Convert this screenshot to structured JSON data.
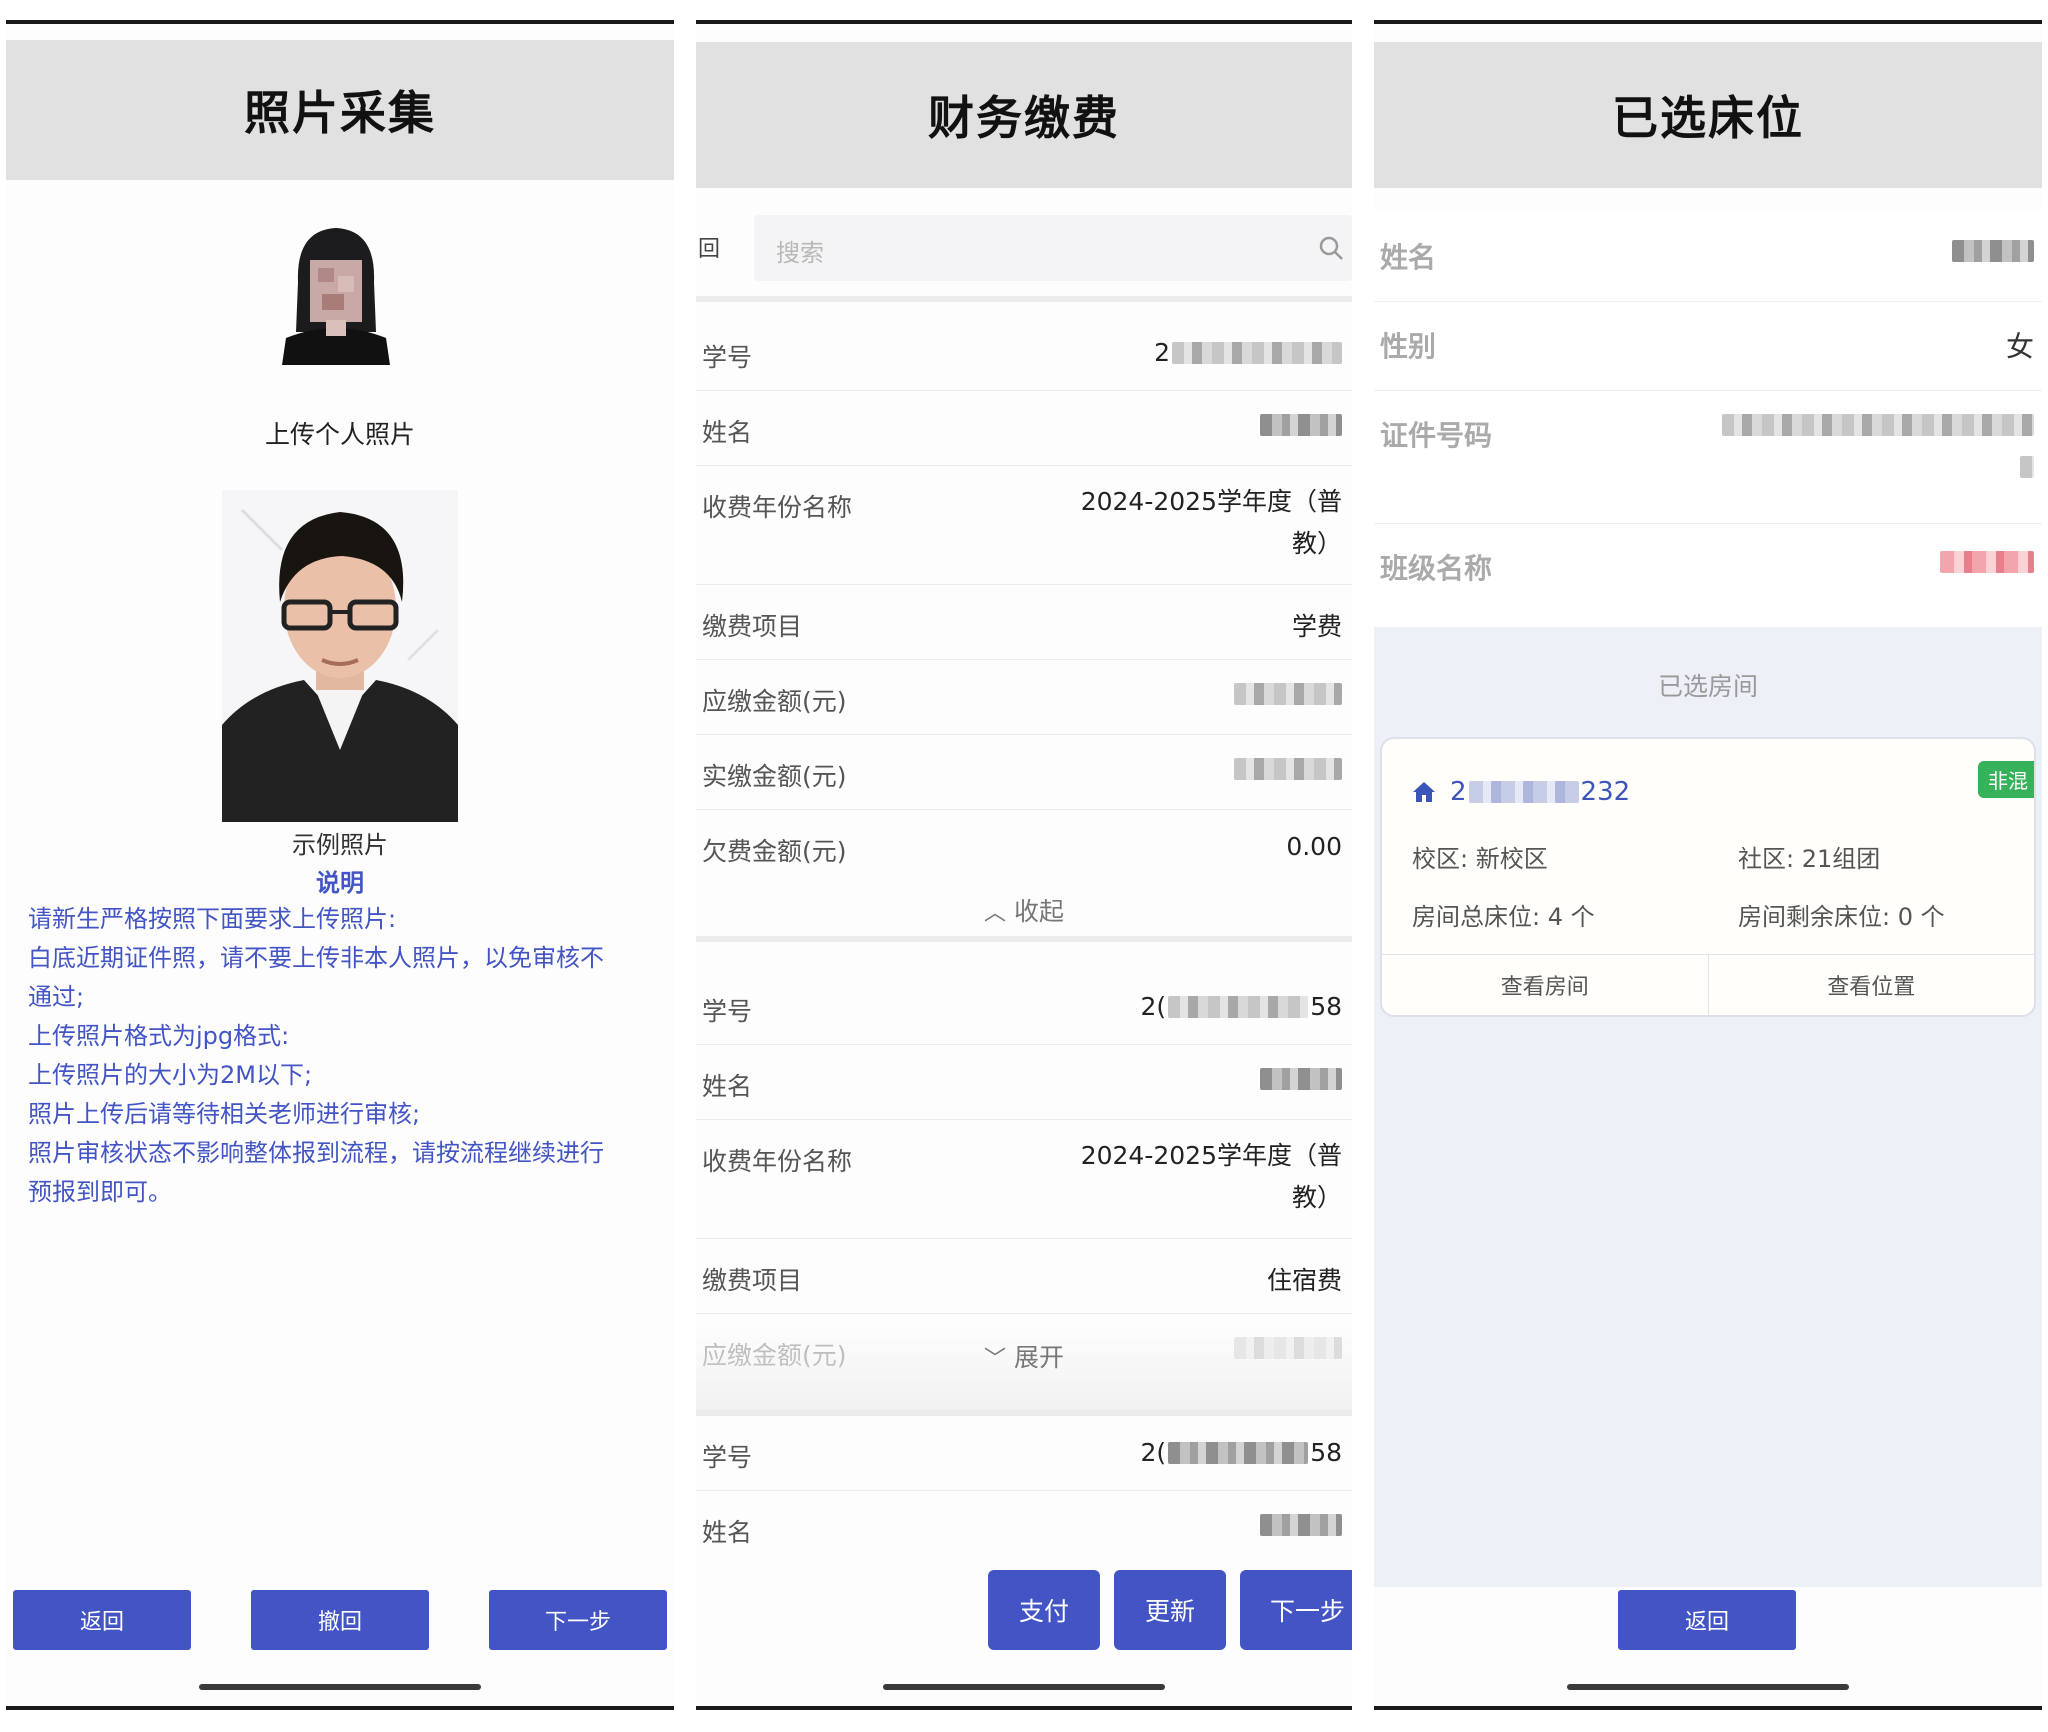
{
  "photo_panel": {
    "title": "照片采集",
    "upload_label": "上传个人照片",
    "example_label": "示例照片",
    "desc_title": "说明",
    "desc_lines": [
      "请新生严格按照下面要求上传照片:",
      "白底近期证件照，请不要上传非本人照片，以免审核不",
      "通过;",
      "上传照片格式为jpg格式:",
      "上传照片的大小为2M以下;",
      "照片上传后请等待相关老师进行审核;",
      "照片审核状态不影响整体报到流程，请按流程继续进行",
      "预报到即可。"
    ],
    "buttons": {
      "back": "返回",
      "withdraw": "撤回",
      "next": "下一步"
    }
  },
  "finance_panel": {
    "title": "财务缴费",
    "back_glyph": "回",
    "search_placeholder": "搜索",
    "labels": {
      "student_id": "学号",
      "name": "姓名",
      "fee_year": "收费年份名称",
      "fee_item": "缴费项目",
      "due": "应缴金额(元)",
      "paid": "实缴金额(元)",
      "owed": "欠费金额(元)"
    },
    "record1": {
      "id_prefix": "2",
      "fee_year_line1": "2024-2025学年度（普",
      "fee_year_line2": "教）",
      "fee_item": "学费",
      "owed": "0.00",
      "collapse": "收起"
    },
    "record2": {
      "id_prefix": "2(",
      "id_suffix": "58",
      "fee_year_line1": "2024-2025学年度（普",
      "fee_year_line2": "教）",
      "fee_item": "住宿费",
      "expand": "展开"
    },
    "record3": {
      "id_prefix": "2(",
      "id_suffix": "58"
    },
    "buttons": {
      "pay": "支付",
      "update": "更新",
      "next": "下一步"
    }
  },
  "bed_panel": {
    "title": "已选床位",
    "labels": {
      "name": "姓名",
      "gender": "性别",
      "id_number": "证件号码",
      "class_name": "班级名称"
    },
    "gender_value": "女",
    "selected_room_title": "已选房间",
    "room": {
      "badge": "非混",
      "code_prefix": "2",
      "code_suffix": "232",
      "campus": "校区: 新校区",
      "community": "社区: 21组团",
      "total_beds": "房间总床位: 4 个",
      "remaining_beds": "房间剩余床位: 0 个",
      "view_room": "查看房间",
      "view_location": "查看位置"
    },
    "back_button": "返回"
  },
  "colors": {
    "accent": "#4355c4",
    "header_bg": "#e1e1e1",
    "badge_green": "#36b35a"
  }
}
